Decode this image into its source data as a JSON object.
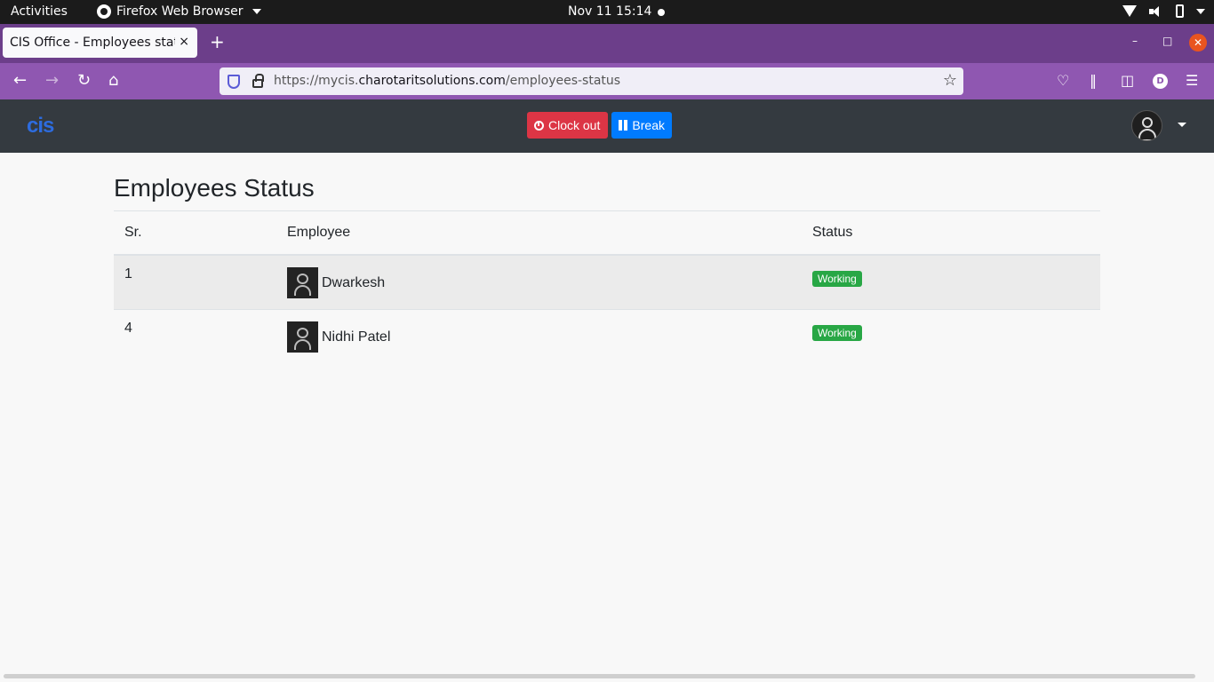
{
  "system": {
    "activities": "Activities",
    "app_name": "Firefox Web Browser",
    "clock": "Nov 11  15:14"
  },
  "browser": {
    "tab_title": "CIS Office - Employees status",
    "tab_close": "×",
    "new_tab": "+",
    "url_prefix": "https://mycis.",
    "url_domain": "charotaritsolutions.com",
    "url_path": "/employees-status",
    "profile_initial": "D"
  },
  "app": {
    "logo_text": "cis",
    "clock_out_label": "Clock out",
    "break_label": "Break"
  },
  "page": {
    "title": "Employees Status",
    "columns": {
      "sr": "Sr.",
      "employee": "Employee",
      "status": "Status"
    },
    "rows": [
      {
        "sr": "1",
        "employee": "Dwarkesh",
        "status": "Working"
      },
      {
        "sr": "4",
        "employee": "Nidhi Patel",
        "status": "Working"
      }
    ]
  },
  "colors": {
    "tabbar": "#6c3e8a",
    "navbar": "#8f57b1",
    "header": "#343a40",
    "danger": "#dc3545",
    "primary": "#007bff",
    "success": "#28a745"
  }
}
